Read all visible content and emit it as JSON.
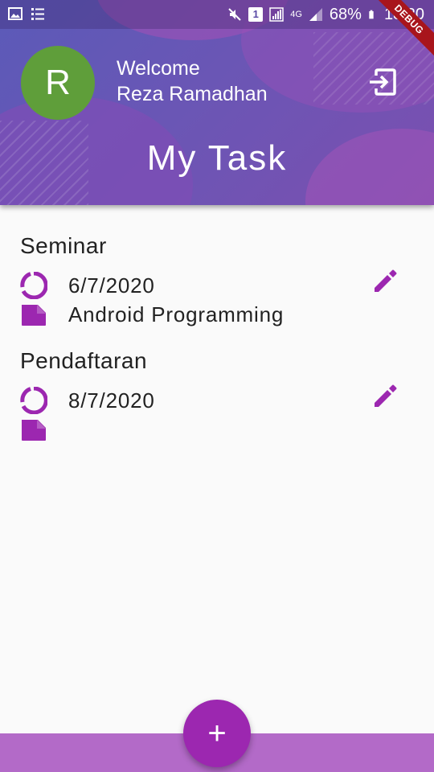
{
  "status_bar": {
    "battery": "68%",
    "time": "18:20",
    "debug_label": "DEBUG",
    "sim": "1",
    "network": "4G"
  },
  "header": {
    "avatar_letter": "R",
    "welcome": "Welcome",
    "user_name": "Reza Ramadhan",
    "title": "My Task"
  },
  "tasks": [
    {
      "title": "Seminar",
      "date": "6/7/2020",
      "description": "Android Programming"
    },
    {
      "title": "Pendaftaran",
      "date": "8/7/2020",
      "description": ""
    }
  ],
  "fab_label": "+",
  "colors": {
    "accent": "#9c27b0",
    "avatar": "#5f9e3a",
    "bottom_bar": "#b36ac8"
  }
}
